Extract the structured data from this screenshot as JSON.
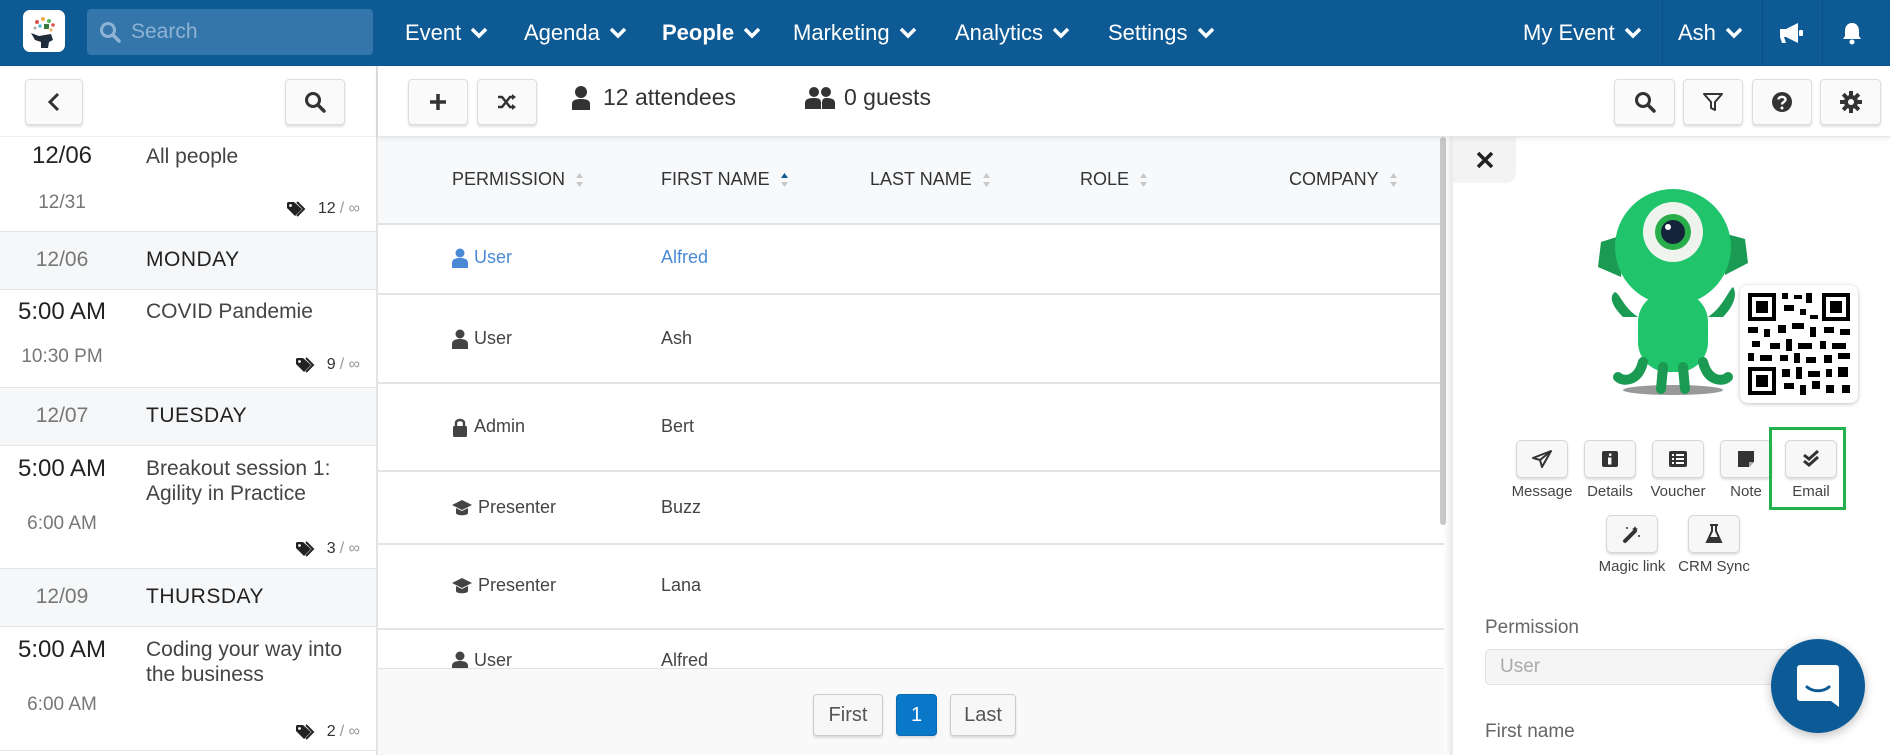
{
  "topnav": {
    "search_placeholder": "Search",
    "items": [
      {
        "label": "Event"
      },
      {
        "label": "Agenda"
      },
      {
        "label": "People",
        "active": true
      },
      {
        "label": "Marketing"
      },
      {
        "label": "Analytics"
      },
      {
        "label": "Settings"
      }
    ],
    "event_label": "My Event",
    "user_label": "Ash",
    "icons": [
      "megaphone-icon",
      "bell-icon"
    ]
  },
  "toolbar": {
    "attendees": "12 attendees",
    "guests": "0 guests"
  },
  "agenda": [
    {
      "type": "session",
      "start": "12/06",
      "end": "12/31",
      "title": "All people",
      "count": "12",
      "capacity": "∞"
    },
    {
      "type": "day",
      "date": "12/06",
      "name": "MONDAY"
    },
    {
      "type": "session",
      "start": "5:00 AM",
      "end": "10:30 PM",
      "title": "COVID Pandemie",
      "count": "9",
      "capacity": "∞"
    },
    {
      "type": "day",
      "date": "12/07",
      "name": "TUESDAY"
    },
    {
      "type": "session",
      "start": "5:00 AM",
      "end": "6:00 AM",
      "title": "Breakout session 1: Agility in Practice",
      "count": "3",
      "capacity": "∞"
    },
    {
      "type": "day",
      "date": "12/09",
      "name": "THURSDAY"
    },
    {
      "type": "session",
      "start": "5:00 AM",
      "end": "6:00 AM",
      "title": "Coding your way into the business",
      "count": "2",
      "capacity": "∞"
    }
  ],
  "table": {
    "columns": [
      "PERMISSION",
      "FIRST NAME",
      "LAST NAME",
      "ROLE",
      "COMPANY"
    ],
    "sorted_column": "FIRST NAME",
    "sort_direction": "ascending",
    "rows": [
      {
        "permission": "User",
        "perm_icon": "user-icon",
        "first_name": "Alfred",
        "last_name": "",
        "role": "",
        "company": "",
        "selected": true
      },
      {
        "permission": "User",
        "perm_icon": "user-icon",
        "first_name": "Ash",
        "last_name": "",
        "role": "",
        "company": ""
      },
      {
        "permission": "Admin",
        "perm_icon": "lock-icon",
        "first_name": "Bert",
        "last_name": "",
        "role": "",
        "company": ""
      },
      {
        "permission": "Presenter",
        "perm_icon": "graduation-cap-icon",
        "first_name": "Buzz",
        "last_name": "",
        "role": "",
        "company": ""
      },
      {
        "permission": "Presenter",
        "perm_icon": "graduation-cap-icon",
        "first_name": "Lana",
        "last_name": "",
        "role": "",
        "company": ""
      },
      {
        "permission": "User",
        "perm_icon": "user-icon",
        "first_name": "Alfred",
        "last_name": "",
        "role": "",
        "company": ""
      }
    ]
  },
  "pagination": {
    "first": "First",
    "current": "1",
    "last": "Last"
  },
  "panel": {
    "actions_row1": [
      {
        "label": "Message",
        "icon": "paper-plane-icon"
      },
      {
        "label": "Details",
        "icon": "info-icon"
      },
      {
        "label": "Voucher",
        "icon": "list-icon"
      },
      {
        "label": "Note",
        "icon": "sticky-note-icon"
      },
      {
        "label": "Email",
        "icon": "double-check-icon",
        "highlighted": true
      }
    ],
    "actions_row2": [
      {
        "label": "Magic link",
        "icon": "magic-wand-icon"
      },
      {
        "label": "CRM Sync",
        "icon": "flask-icon"
      }
    ],
    "fields": {
      "permission_label": "Permission",
      "permission_value": "User",
      "first_name_label": "First name"
    }
  },
  "colors": {
    "nav": "#0e5a95",
    "selected_row": "#4a8ad4",
    "active_page": "#0a78c8",
    "highlight": "#22b14c",
    "chat": "#0d5b96"
  }
}
